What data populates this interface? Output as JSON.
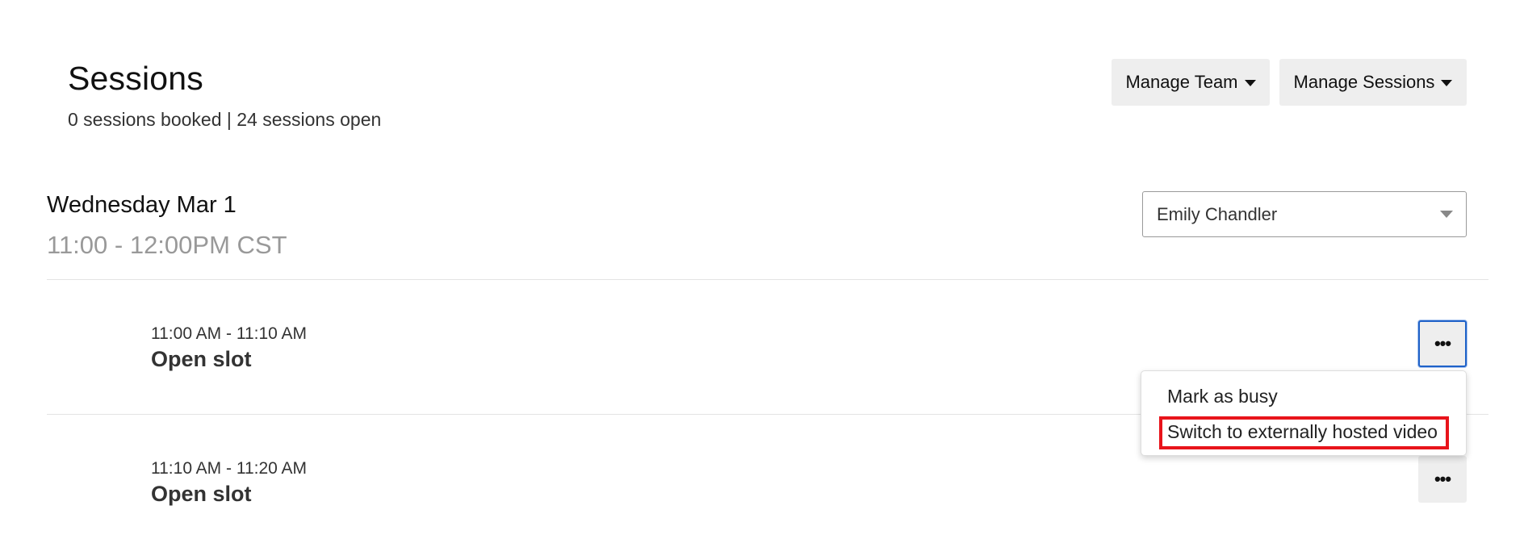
{
  "header": {
    "title": "Sessions",
    "summary": "0 sessions booked | 24 sessions open",
    "manage_team_label": "Manage Team",
    "manage_sessions_label": "Manage Sessions"
  },
  "day": {
    "title": "Wednesday Mar 1",
    "time_range": "11:00 - 12:00PM CST",
    "host_select_value": "Emily Chandler"
  },
  "slots": [
    {
      "time": "11:00 AM - 11:10 AM",
      "status": "Open slot",
      "more_label": "•••"
    },
    {
      "time": "11:10 AM - 11:20 AM",
      "status": "Open slot",
      "more_label": "•••"
    }
  ],
  "menu": {
    "items": [
      {
        "label": "Mark as busy"
      },
      {
        "label": "Switch to externally hosted video"
      }
    ]
  },
  "colors": {
    "focus_ring": "#1f62c8",
    "highlight_box": "#e8141b",
    "button_bg": "#eeeeee"
  }
}
